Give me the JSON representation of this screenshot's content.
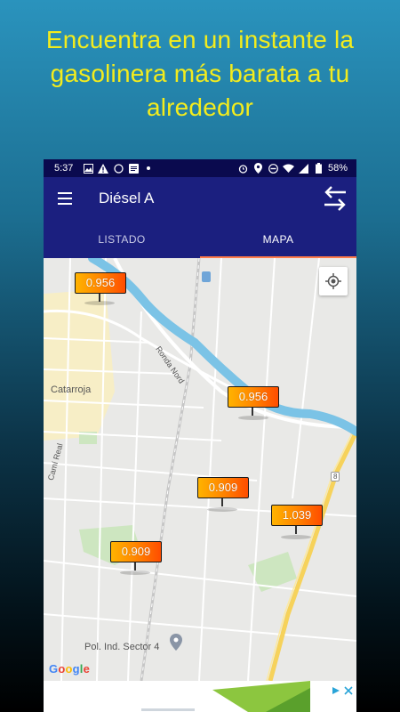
{
  "headline": "Encuentra en un instante la gasolinera más barata a tu alrededor",
  "status": {
    "time": "5:37",
    "battery": "58%"
  },
  "app": {
    "title": "Diésel A"
  },
  "tabs": [
    {
      "label": "LISTADO"
    },
    {
      "label": "MAPA"
    }
  ],
  "map": {
    "place_labels": {
      "city": "Catarroja",
      "road1": "Ronda Nord",
      "road2": "Camí Real",
      "poi": "Pol. Ind. Sector 4",
      "route": "8"
    },
    "prices": [
      {
        "value": "0.956"
      },
      {
        "value": "0.956"
      },
      {
        "value": "0.909"
      },
      {
        "value": "1.039"
      },
      {
        "value": "0.909"
      }
    ],
    "attribution": "Google"
  },
  "colors": {
    "headline": "#f3ec1d",
    "appbar": "#1b1f7f",
    "statusbar": "#0a0a4e",
    "tab_indicator": "#ff7b4a",
    "river": "#7bc3e6"
  }
}
